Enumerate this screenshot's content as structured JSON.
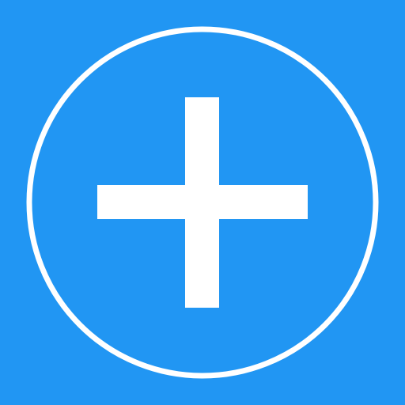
{
  "icon": {
    "name": "add-icon",
    "colors": {
      "background": "#2196F3",
      "foreground": "#FFFFFF"
    }
  }
}
